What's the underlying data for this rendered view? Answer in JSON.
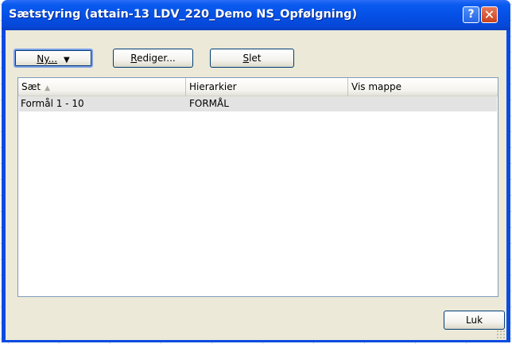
{
  "window": {
    "title": "Sætstyring (attain-13 LDV_220_Demo NS_Opfølgning)",
    "help_label": "?",
    "close_label": "✕"
  },
  "toolbar": {
    "new_label": "Ny...",
    "new_caret": "▼",
    "edit_label_underlined": "R",
    "edit_label_rest": "ediger...",
    "delete_label_underlined": "S",
    "delete_label_rest": "let"
  },
  "list": {
    "columns": [
      "Sæt",
      "Hierarkier",
      "Vis mappe"
    ],
    "sort_indicator": "▲",
    "rows": [
      {
        "saet": "Formål 1 - 10",
        "hierarkier": "FORMÅL",
        "vis_mappe": ""
      }
    ]
  },
  "footer": {
    "close_button_label": "Luk"
  },
  "icons": {
    "help": "question-mark-icon",
    "close": "close-x-icon",
    "dropdown": "triangle-down-icon",
    "sort": "sort-ascending-icon",
    "grip": "resize-grip-icon"
  }
}
